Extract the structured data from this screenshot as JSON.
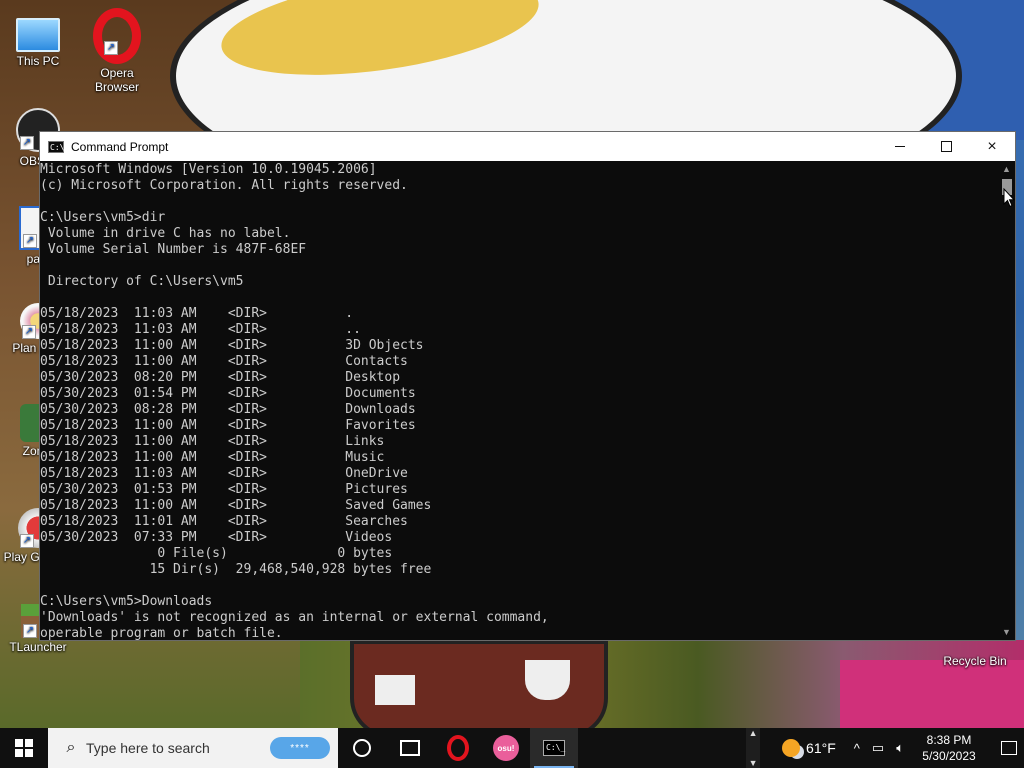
{
  "desktop": {
    "icons": [
      {
        "label": "This PC",
        "icon": "this-pc-icon"
      },
      {
        "label": "Opera Browser",
        "icon": "opera-icon"
      },
      {
        "label": "OBS S",
        "icon": "obs-studio-icon"
      },
      {
        "label": "pain",
        "icon": "paint-icon"
      },
      {
        "label": "Plan Zom",
        "icon": "plants-vs-zombies-icon"
      },
      {
        "label": "Zomb",
        "icon": "zombie-game-icon"
      },
      {
        "label": "Play Great C",
        "icon": "play-game-icon"
      },
      {
        "label": "TLauncher",
        "icon": "tlauncher-icon"
      },
      {
        "label": "Recycle Bin",
        "icon": "recycle-bin-icon"
      }
    ]
  },
  "window": {
    "title": "Command Prompt",
    "icon": "cmd-icon",
    "icon_text": "C:\\_",
    "controls": {
      "minimize": "minimize-icon",
      "maximize": "maximize-icon",
      "close": "×"
    }
  },
  "console": {
    "lines": [
      "Microsoft Windows [Version 10.0.19045.2006]",
      "(c) Microsoft Corporation. All rights reserved.",
      "",
      "C:\\Users\\vm5>dir",
      " Volume in drive C has no label.",
      " Volume Serial Number is 487F-68EF",
      "",
      " Directory of C:\\Users\\vm5",
      "",
      "05/18/2023  11:03 AM    <DIR>          .",
      "05/18/2023  11:03 AM    <DIR>          ..",
      "05/18/2023  11:00 AM    <DIR>          3D Objects",
      "05/18/2023  11:00 AM    <DIR>          Contacts",
      "05/30/2023  08:20 PM    <DIR>          Desktop",
      "05/30/2023  01:54 PM    <DIR>          Documents",
      "05/30/2023  08:28 PM    <DIR>          Downloads",
      "05/18/2023  11:00 AM    <DIR>          Favorites",
      "05/18/2023  11:00 AM    <DIR>          Links",
      "05/18/2023  11:00 AM    <DIR>          Music",
      "05/18/2023  11:03 AM    <DIR>          OneDrive",
      "05/30/2023  01:53 PM    <DIR>          Pictures",
      "05/18/2023  11:00 AM    <DIR>          Saved Games",
      "05/18/2023  11:01 AM    <DIR>          Searches",
      "05/30/2023  07:33 PM    <DIR>          Videos",
      "               0 File(s)              0 bytes",
      "              15 Dir(s)  29,468,540,928 bytes free",
      "",
      "C:\\Users\\vm5>Downloads",
      "'Downloads' is not recognized as an internal or external command,",
      "operable program or batch file."
    ]
  },
  "taskbar": {
    "start_icon": "windows-start-icon",
    "search_placeholder": "Type here to search",
    "search_badge": "****",
    "apps": [
      {
        "name": "cortana",
        "icon": "cortana-icon"
      },
      {
        "name": "task-view",
        "icon": "task-view-icon"
      },
      {
        "name": "opera",
        "icon": "opera-icon"
      },
      {
        "name": "osu",
        "icon": "osu-icon",
        "text": "osu!"
      },
      {
        "name": "command-prompt",
        "icon": "cmd-icon",
        "active": true
      }
    ],
    "weather": {
      "temp": "61°F",
      "icon": "partly-sunny-icon"
    },
    "tray_chevron": "^",
    "clock": {
      "time": "8:38 PM",
      "date": "5/30/2023"
    },
    "notification_icon": "notification-icon"
  },
  "colors": {
    "console_bg": "#0c0c0c",
    "console_text": "#cccccc",
    "taskbar_bg": "#101010",
    "accent": "#7ab4f0"
  }
}
